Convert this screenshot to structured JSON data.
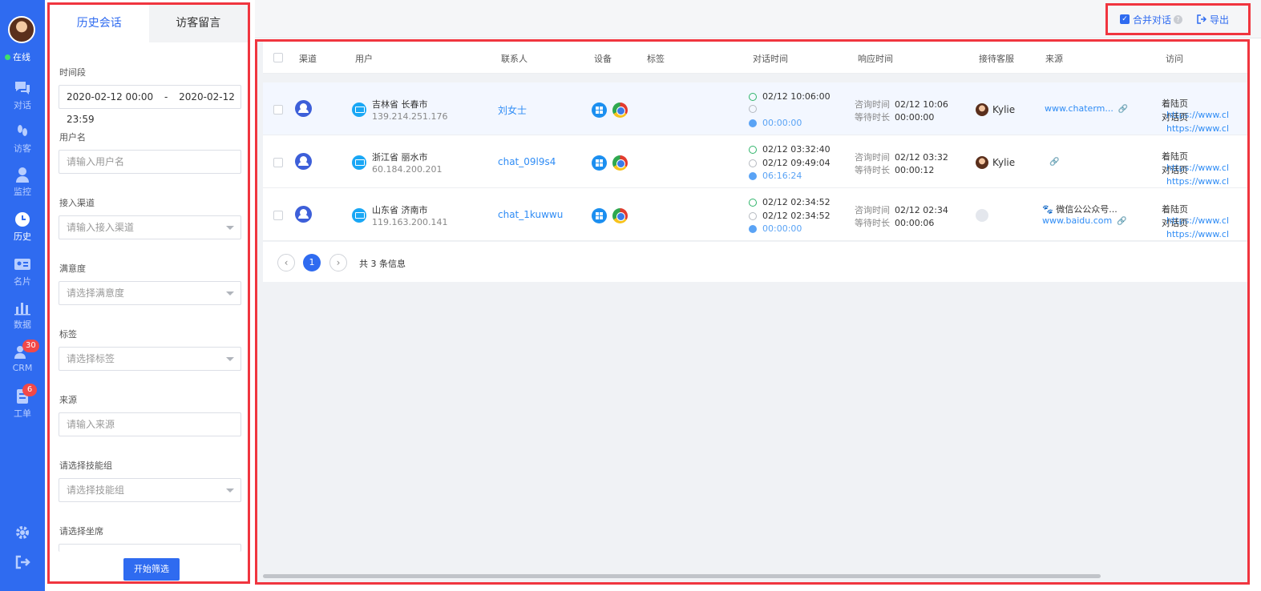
{
  "nav": {
    "status": "在线",
    "items": [
      {
        "label": "对话",
        "icon": "chat-icon"
      },
      {
        "label": "访客",
        "icon": "footprint-icon"
      },
      {
        "label": "监控",
        "icon": "person-icon"
      },
      {
        "label": "历史",
        "icon": "clock-icon"
      },
      {
        "label": "名片",
        "icon": "card-icon"
      },
      {
        "label": "数据",
        "icon": "bar-chart-icon"
      },
      {
        "label": "CRM",
        "icon": "crm-icon",
        "badge": "30"
      },
      {
        "label": "工单",
        "icon": "ticket-icon",
        "badge": "6"
      }
    ],
    "active": "历史"
  },
  "filter": {
    "tabs": [
      "历史会话",
      "访客留言"
    ],
    "active_tab": "历史会话",
    "time_label": "时间段",
    "time_start": "2020-02-12 00:00",
    "time_sep": "-",
    "time_end": "2020-02-12 23:59",
    "username_label": "用户名",
    "username_placeholder": "请输入用户名",
    "channel_label": "接入渠道",
    "channel_placeholder": "请输入接入渠道",
    "satisfaction_label": "满意度",
    "satisfaction_placeholder": "请选择满意度",
    "tag_label": "标签",
    "tag_placeholder": "请选择标签",
    "source_label": "来源",
    "source_placeholder": "请输入来源",
    "skillgroup_label": "请选择技能组",
    "skillgroup_placeholder": "请选择技能组",
    "seat_label": "请选择坐席",
    "start_button": "开始筛选"
  },
  "toolbar": {
    "merge_label": "合并对话",
    "merge_checked": true,
    "export_label": "导出",
    "check_mark": "✓",
    "help_mark": "?"
  },
  "table": {
    "headers": {
      "channel": "渠道",
      "user": "用户",
      "contact": "联系人",
      "device": "设备",
      "tag": "标签",
      "dialog_time": "对话时间",
      "response_time": "响应时间",
      "agent": "接待客服",
      "source": "来源",
      "visit": "访问"
    },
    "consult_key": "咨询时间",
    "wait_key": "等待时长",
    "landing_key": "着陆页",
    "dialog_key": "对话页",
    "rows": [
      {
        "city": "吉林省 长春市",
        "ip": "139.214.251.176",
        "contact": "刘女士",
        "start": "02/12 10:06:00",
        "end": "",
        "duration": "00:00:00",
        "consult": "02/12 10:06",
        "wait": "00:00:00",
        "agent": "Kylie",
        "source": "www.chaterm...",
        "source2": "",
        "landing_url": "https://www.cl",
        "dialog_url": "https://www.cl"
      },
      {
        "city": "浙江省 丽水市",
        "ip": "60.184.200.201",
        "contact": "chat_09l9s4",
        "start": "02/12 03:32:40",
        "end": "02/12 09:49:04",
        "duration": "06:16:24",
        "consult": "02/12 03:32",
        "wait": "00:00:12",
        "agent": "Kylie",
        "source": "",
        "source2": "",
        "landing_url": "https://www.cl",
        "dialog_url": "https://www.cl"
      },
      {
        "city": "山东省 济南市",
        "ip": "119.163.200.141",
        "contact": "chat_1kuwwu",
        "start": "02/12 02:34:52",
        "end": "02/12 02:34:52",
        "duration": "00:00:00",
        "consult": "02/12 02:34",
        "wait": "00:00:06",
        "agent": "",
        "source": "微信公公众号...",
        "source2": "www.baidu.com",
        "landing_url": "https://www.cl",
        "dialog_url": "https://www.cl"
      }
    ]
  },
  "pagination": {
    "current": "1",
    "prev": "‹",
    "next": "›",
    "total_text": "共 3 条信息"
  },
  "colors": {
    "rail": "#2f6bf0",
    "accent": "#2f6bf0",
    "highlight_border": "#f0353f",
    "link": "#2f8cf5"
  }
}
